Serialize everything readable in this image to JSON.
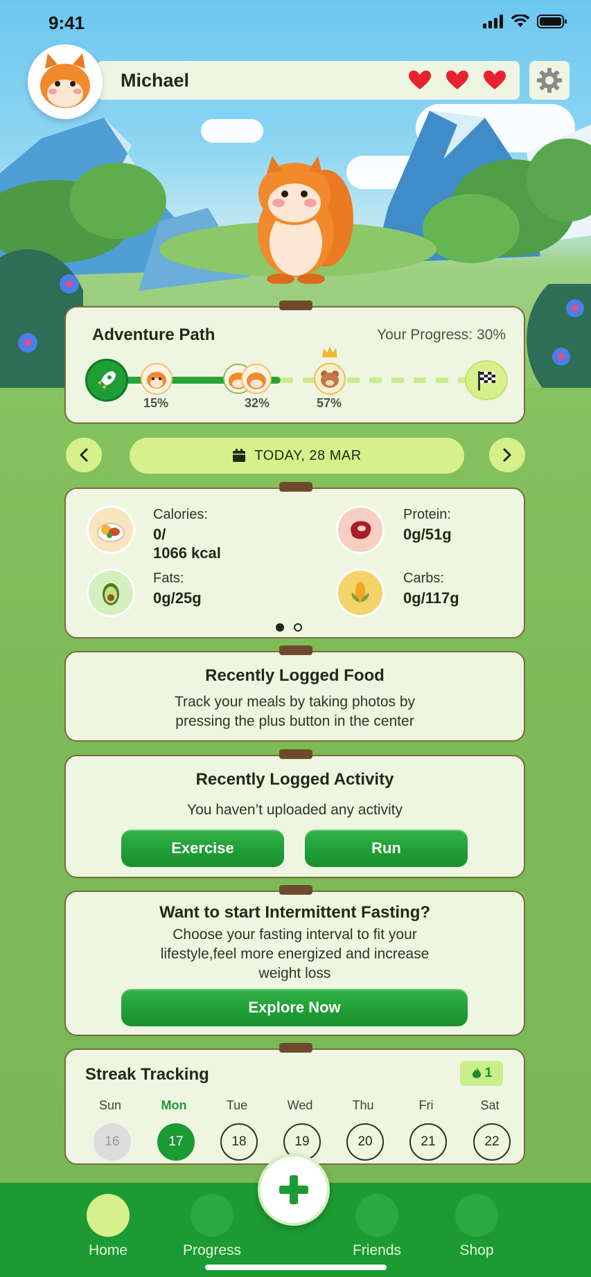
{
  "status_bar": {
    "time": "9:41"
  },
  "header": {
    "user_name": "Michael",
    "lives": 3
  },
  "adventure_path": {
    "title": "Adventure Path",
    "progress_text": "Your Progress: 30%",
    "progress_fraction": 0.3,
    "milestones": [
      "15%",
      "32%",
      "57%"
    ]
  },
  "date_bar": {
    "label": "TODAY, 28 MAR"
  },
  "nutrition": {
    "calories": {
      "label": "Calories:",
      "value_line1": "0/",
      "value_line2": "1066 kcal"
    },
    "protein": {
      "label": "Protein:",
      "value": "0g/51g"
    },
    "fats": {
      "label": "Fats:",
      "value": "0g/25g"
    },
    "carbs": {
      "label": "Carbs:",
      "value": "0g/117g"
    },
    "page_count": 2,
    "active_page": 1
  },
  "recent_food": {
    "title": "Recently Logged Food",
    "line1": "Track your meals by taking photos by",
    "line2": "pressing the plus button in the center"
  },
  "recent_activity": {
    "title": "Recently Logged Activity",
    "message": "You haven’t uploaded any activity",
    "exercise_label": "Exercise",
    "run_label": "Run"
  },
  "fasting": {
    "title": "Want to start Intermittent Fasting?",
    "line1": "Choose your fasting interval to fit your",
    "line2": "lifestyle,feel more energized and increase",
    "line3": "weight loss",
    "button_label": "Explore Now"
  },
  "streak": {
    "title": "Streak Tracking",
    "count": "1",
    "days": [
      {
        "name": "Sun",
        "date": "16",
        "state": "past"
      },
      {
        "name": "Mon",
        "date": "17",
        "state": "active"
      },
      {
        "name": "Tue",
        "date": "18",
        "state": "future"
      },
      {
        "name": "Wed",
        "date": "19",
        "state": "future"
      },
      {
        "name": "Thu",
        "date": "20",
        "state": "future"
      },
      {
        "name": "Fri",
        "date": "21",
        "state": "future"
      },
      {
        "name": "Sat",
        "date": "22",
        "state": "future"
      }
    ]
  },
  "bottom_nav": {
    "home": "Home",
    "progress": "Progress",
    "friends": "Friends",
    "shop": "Shop",
    "active": "home"
  },
  "colors": {
    "accent_green": "#1c9a34",
    "light_lime": "#d6f08b",
    "card_bg": "#eef6e2",
    "heart_red": "#e8232f",
    "tab_brown": "#6e4a2c"
  }
}
